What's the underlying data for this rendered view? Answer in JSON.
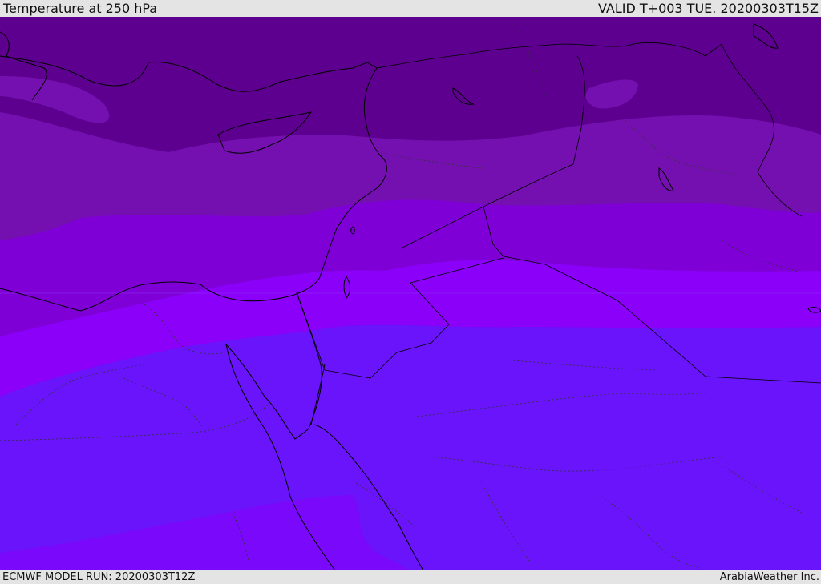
{
  "header": {
    "title": "Temperature at 250 hPa",
    "valid": "VALID T+003 TUE. 20200303T15Z"
  },
  "footer": {
    "model_run": "ECMWF MODEL RUN: 20200303T12Z",
    "credit": "ArabiaWeather Inc."
  },
  "colors": {
    "band_darkest": "#5e008f",
    "band_2": "#7510b0",
    "band_3": "#7e00d6",
    "band_4": "#8a00f8",
    "band_5": "#6a14fb",
    "band_6": "#7a08fa",
    "coastline": "#000000",
    "border_dotted": "#333333"
  },
  "icons": [
    "coastline-layer",
    "country-border-layer",
    "region-border-layer"
  ]
}
